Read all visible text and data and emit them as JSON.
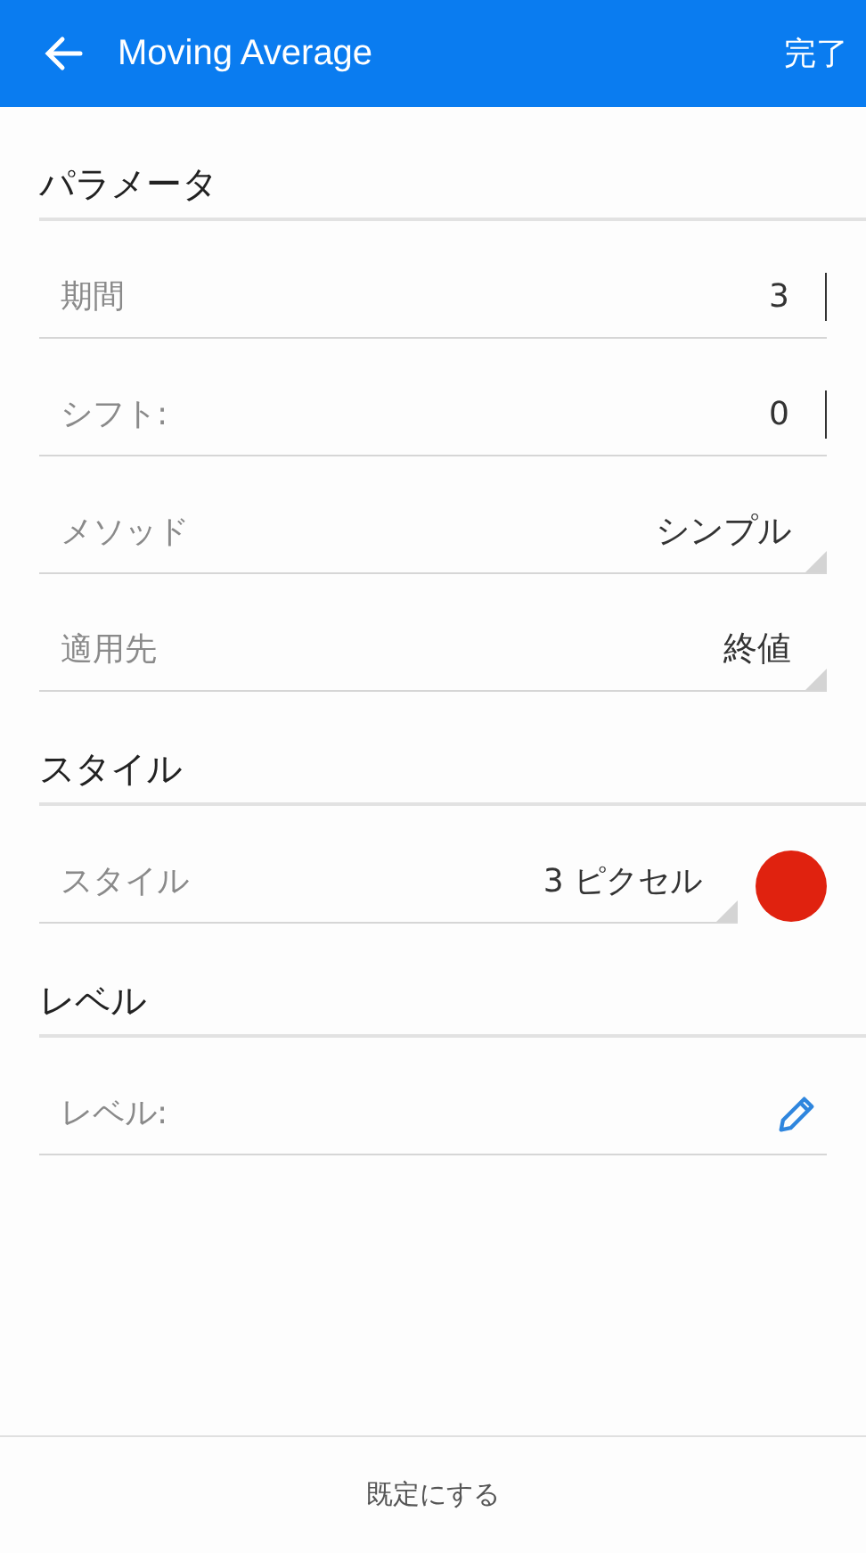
{
  "app_bar": {
    "title": "Moving Average",
    "action": "完了"
  },
  "sections": [
    {
      "title": "パラメータ",
      "rows": [
        {
          "kind": "input",
          "label": "期間",
          "value": "3"
        },
        {
          "kind": "input",
          "label": "シフト:",
          "value": "0"
        },
        {
          "kind": "select",
          "label": "メソッド",
          "value": "シンプル"
        },
        {
          "kind": "select",
          "label": "適用先",
          "value": "終値"
        }
      ]
    },
    {
      "title": "スタイル",
      "rows": [
        {
          "kind": "select_color",
          "label": "スタイル",
          "value": "3 ピクセル",
          "color": "#e0220f"
        }
      ]
    },
    {
      "title": "レベル",
      "rows": [
        {
          "kind": "edit",
          "label": "レベル:"
        }
      ]
    }
  ],
  "footer": {
    "button": "既定にする"
  }
}
